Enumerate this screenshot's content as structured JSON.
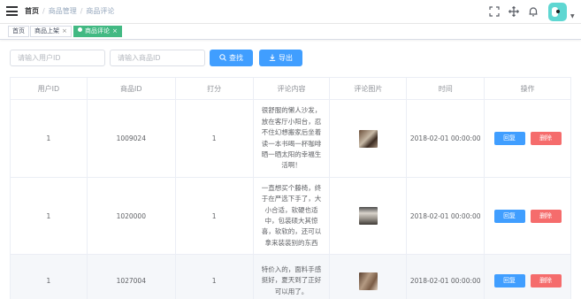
{
  "header": {
    "breadcrumb": [
      "首页",
      "商品管理",
      "商品评论"
    ],
    "separator": "/"
  },
  "tags": [
    {
      "label": "首页",
      "active": false
    },
    {
      "label": "商品上架",
      "active": false
    },
    {
      "label": "商品评论",
      "active": true
    }
  ],
  "tag_close": "×",
  "filters": {
    "user_id_placeholder": "请输入用户ID",
    "product_id_placeholder": "请输入商品ID",
    "search_label": "查找",
    "export_label": "导出"
  },
  "table": {
    "columns": [
      "用户ID",
      "商品ID",
      "打分",
      "评论内容",
      "评论图片",
      "时间",
      "操作"
    ],
    "rows": [
      {
        "user_id": "1",
        "product_id": "1009024",
        "score": "1",
        "comment": "很舒服的懒人沙发，放在客厅小阳台，忍不住幻想搬家后坐着读一本书喝一杯咖啡晒一晒太阳的幸福生活啊！",
        "time": "2018-02-01 00:00:00"
      },
      {
        "user_id": "1",
        "product_id": "1020000",
        "score": "1",
        "comment": "一直想买个藤椅，终于在严选下手了，大小合适，软硬也适中，包装硕大其惊喜，软软的，还可以拿来装装别的东西",
        "time": "2018-02-01 00:00:00"
      },
      {
        "user_id": "1",
        "product_id": "1027004",
        "score": "1",
        "comment": "特价入的，面料手感挺好，夏天到了正好可以用了。",
        "time": "2018-02-01 00:00:00"
      }
    ],
    "reply_label": "回复",
    "delete_label": "删除"
  },
  "colors": {
    "primary": "#409eff",
    "danger": "#f56c6c",
    "tag_active": "#42b983",
    "avatar_bg": "#5fd7d2"
  },
  "icons": [
    "hamburger-icon",
    "fullscreen-icon",
    "size-icon",
    "bell-icon",
    "search-icon",
    "download-icon"
  ]
}
